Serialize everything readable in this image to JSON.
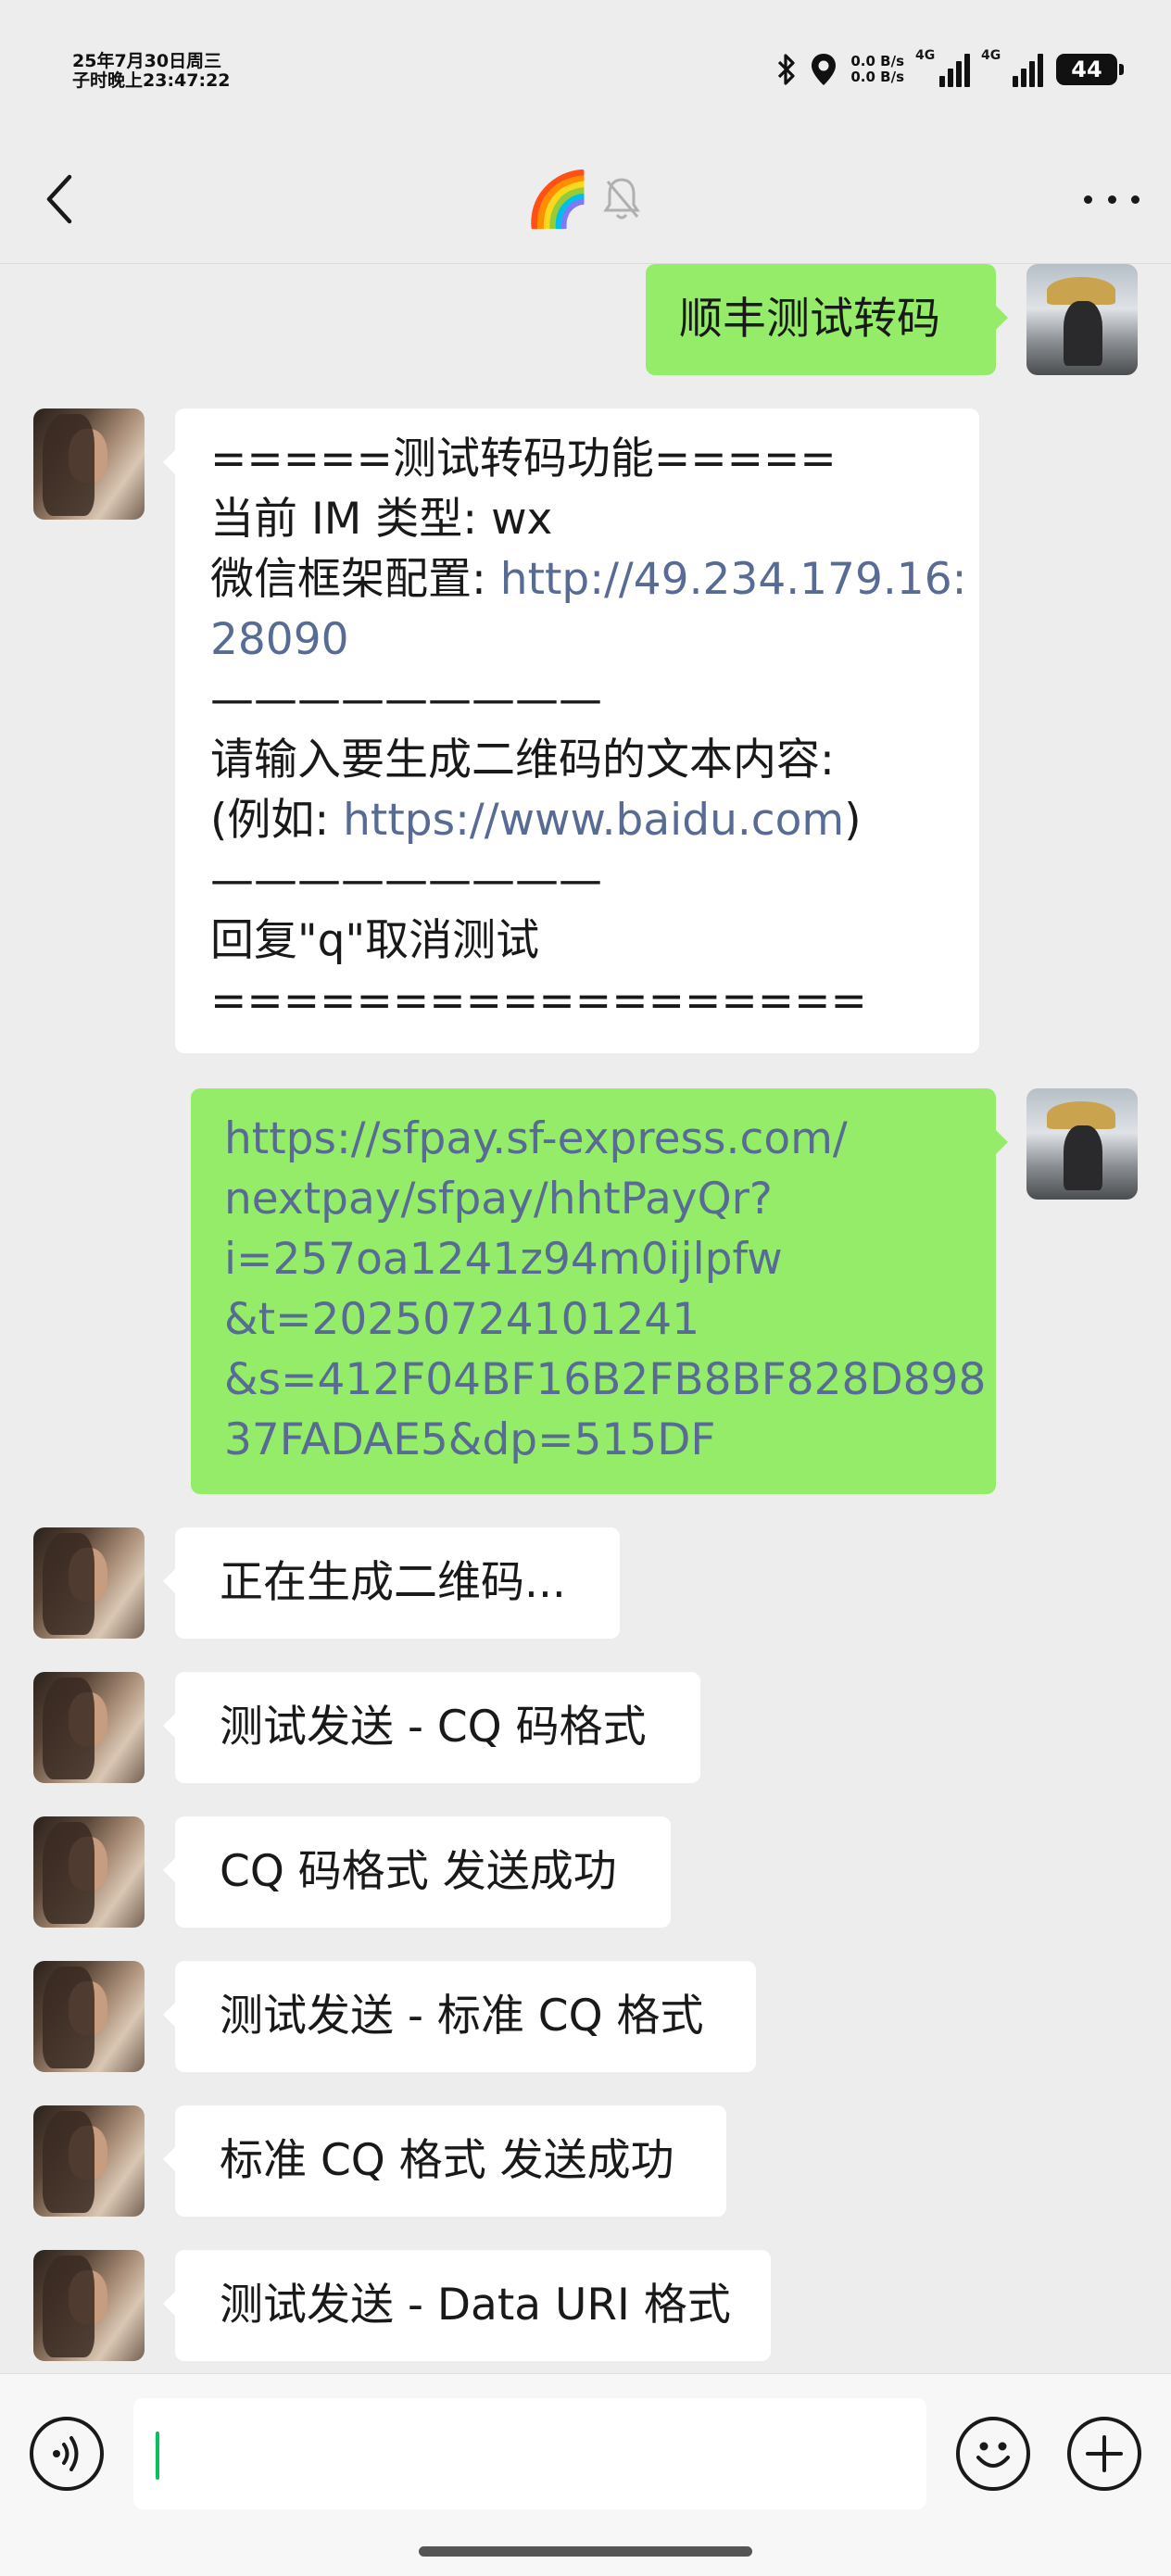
{
  "status_bar": {
    "time_line1": "25年7月30日周三",
    "time_line2": "子时晚上23:47:22",
    "net_up": "0.0 B/s",
    "net_down": "0.0 B/s",
    "sim1_label": "4G",
    "sim2_label": "4G",
    "battery_level": "44"
  },
  "nav": {
    "title_emoji": "🌈",
    "muted": true,
    "more_icon": "more-dots-icon",
    "back_icon": "chevron-left-icon"
  },
  "messages": [
    {
      "from": "self",
      "lines": [
        {
          "text": "顺丰测试转码",
          "link": false
        }
      ]
    },
    {
      "from": "other",
      "lines": [
        {
          "text": "=====测试转码功能=====",
          "link": false
        },
        {
          "text": "当前 IM 类型: wx",
          "link": false
        },
        {
          "label": "微信框架配置: ",
          "text": "http://49.234.179.16:",
          "link": true
        },
        {
          "text": "28090",
          "link": true
        },
        {
          "text": "—————————",
          "link": false
        },
        {
          "text": "请输入要生成二维码的文本内容:",
          "link": false
        },
        {
          "label": "(例如: ",
          "text": "https://www.baidu.com",
          "suffix": ")",
          "link": true
        },
        {
          "text": "—————————",
          "link": false
        },
        {
          "text": "回复\"q\"取消测试",
          "link": false
        },
        {
          "text": "==================",
          "link": false
        }
      ]
    },
    {
      "from": "self",
      "lines": [
        {
          "text": "https://sfpay.sf-express.com/",
          "link": true
        },
        {
          "text": "nextpay/sfpay/hhtPayQr?",
          "link": true
        },
        {
          "text": "i=257oa1241z94m0ijlpfw",
          "link": true
        },
        {
          "text": "&t=20250724101241",
          "link": true
        },
        {
          "text": "&s=412F04BF16B2FB8BF828D898",
          "link": true
        },
        {
          "text": "37FADAE5&dp=515DF",
          "link": true
        }
      ]
    },
    {
      "from": "other",
      "lines": [
        {
          "text": "正在生成二维码...",
          "link": false
        }
      ]
    },
    {
      "from": "other",
      "lines": [
        {
          "text": "测试发送 - CQ 码格式",
          "link": false
        }
      ]
    },
    {
      "from": "other",
      "lines": [
        {
          "text": "CQ 码格式 发送成功",
          "link": false
        }
      ]
    },
    {
      "from": "other",
      "lines": [
        {
          "text": "测试发送 - 标准 CQ 格式",
          "link": false
        }
      ]
    },
    {
      "from": "other",
      "lines": [
        {
          "text": "标准 CQ 格式 发送成功",
          "link": false
        }
      ]
    },
    {
      "from": "other",
      "lines": [
        {
          "text": "测试发送 - Data URI 格式",
          "link": false
        }
      ]
    }
  ],
  "input_bar": {
    "voice_icon": "voice-icon",
    "emoji_icon": "emoji-icon",
    "plus_icon": "plus-icon",
    "text_value": ""
  }
}
